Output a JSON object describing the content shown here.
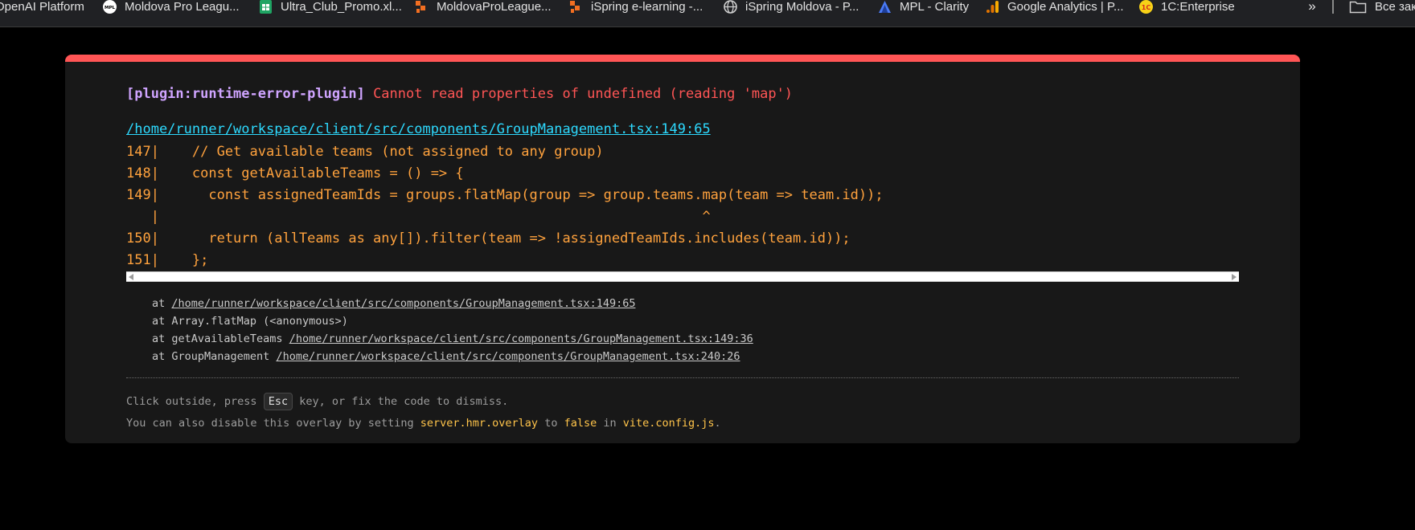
{
  "bookmarks": {
    "items": [
      {
        "label": "OpenAI Platform",
        "icon": "openai-icon"
      },
      {
        "label": "Moldova Pro Leagu...",
        "icon": "mpl-logo-icon"
      },
      {
        "label": "Ultra_Club_Promo.xl...",
        "icon": "sheets-icon"
      },
      {
        "label": "MoldovaProLeague...",
        "icon": "ispring-icon"
      },
      {
        "label": "iSpring e-learning -...",
        "icon": "ispring-icon"
      },
      {
        "label": "iSpring Moldova - P...",
        "icon": "globe-icon"
      },
      {
        "label": "MPL - Clarity",
        "icon": "clarity-icon"
      },
      {
        "label": "Google Analytics | P...",
        "icon": "analytics-icon"
      },
      {
        "label": "1C:Enterprise",
        "icon": "onec-icon"
      }
    ],
    "overflow": "»",
    "folder_label": "Все зак"
  },
  "error": {
    "plugin": "[plugin:runtime-error-plugin]",
    "message": "Cannot read properties of undefined (reading 'map')",
    "file": "/home/runner/workspace/client/src/components/GroupManagement.tsx:149:65",
    "code_lines": [
      "147|    // Get available teams (not assigned to any group)",
      "148|    const getAvailableTeams = () => {",
      "149|      const assignedTeamIds = groups.flatMap(group => group.teams.map(team => team.id));",
      "   |                                                                  ^",
      "150|      return (allTeams as any[]).filter(team => !assignedTeamIds.includes(team.id));",
      "151|    };"
    ],
    "stack": [
      {
        "prefix": "at ",
        "name": "",
        "location": "/home/runner/workspace/client/src/components/GroupManagement.tsx:149:65"
      },
      {
        "prefix": "at ",
        "name": "Array.flatMap (<anonymous>)",
        "location": ""
      },
      {
        "prefix": "at ",
        "name": "getAvailableTeams ",
        "location": "/home/runner/workspace/client/src/components/GroupManagement.tsx:149:36"
      },
      {
        "prefix": "at ",
        "name": "GroupManagement ",
        "location": "/home/runner/workspace/client/src/components/GroupManagement.tsx:240:26"
      }
    ]
  },
  "tips": {
    "line1_a": "Click outside, press ",
    "key": "Esc",
    "line1_b": " key, or fix the code to dismiss.",
    "line2_a": "You can also disable this overlay by setting ",
    "line2_code1": "server.hmr.overlay",
    "line2_b": " to ",
    "line2_code2": "false",
    "line2_c": " in ",
    "line2_code3": "vite.config.js",
    "line2_d": "."
  },
  "colors": {
    "border_top": "#ff5555",
    "plugin": "#cfa4ff",
    "message": "#ff5555",
    "file_link": "#2dd9fe",
    "code": "#ffa23d"
  }
}
